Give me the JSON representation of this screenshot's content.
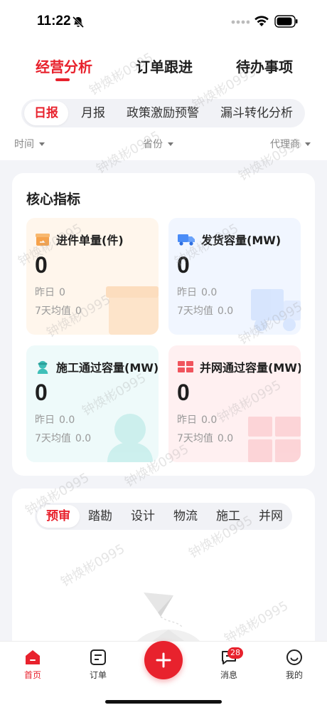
{
  "status_bar": {
    "time": "11:22"
  },
  "main_tabs": [
    {
      "label": "经营分析",
      "active": true
    },
    {
      "label": "订单跟进",
      "active": false
    },
    {
      "label": "待办事项",
      "active": false
    }
  ],
  "sub_tabs": [
    {
      "label": "日报",
      "active": true
    },
    {
      "label": "月报",
      "active": false
    },
    {
      "label": "政策激励预警",
      "active": false
    },
    {
      "label": "漏斗转化分析",
      "active": false
    }
  ],
  "filters": [
    {
      "label": "时间"
    },
    {
      "label": "省份"
    },
    {
      "label": "代理商"
    }
  ],
  "core": {
    "title": "核心指标",
    "yesterday_label": "昨日",
    "avg_label": "7天均值",
    "metrics": [
      {
        "label": "进件单量(件)",
        "value": "0",
        "yesterday": "0",
        "avg7": "0",
        "icon": "box-icon",
        "color": "#f6a24b"
      },
      {
        "label": "发货容量(MW)",
        "value": "0",
        "yesterday": "0.0",
        "avg7": "0.0",
        "icon": "truck-icon",
        "color": "#4a8cf7"
      },
      {
        "label": "施工通过容量(MW)",
        "value": "0",
        "yesterday": "0.0",
        "avg7": "0.0",
        "icon": "worker-icon",
        "color": "#3fbfb8"
      },
      {
        "label": "并网通过容量(MW)",
        "value": "0",
        "yesterday": "0.0",
        "avg7": "0.0",
        "icon": "solar-panel-icon",
        "color": "#f0545d"
      }
    ]
  },
  "flow_tabs": [
    {
      "label": "预审",
      "active": true
    },
    {
      "label": "踏勘",
      "active": false
    },
    {
      "label": "设计",
      "active": false
    },
    {
      "label": "物流",
      "active": false
    },
    {
      "label": "施工",
      "active": false
    },
    {
      "label": "并网",
      "active": false
    }
  ],
  "bottom_nav": {
    "items": [
      {
        "label": "首页",
        "icon": "home-icon",
        "active": true
      },
      {
        "label": "订单",
        "icon": "order-icon",
        "active": false
      },
      {
        "label": "消息",
        "icon": "message-icon",
        "active": false,
        "badge": "28"
      },
      {
        "label": "我的",
        "icon": "profile-icon",
        "active": false
      }
    ],
    "fab_icon": "plus-icon"
  },
  "watermark_text": "钟焕彬0995",
  "colors": {
    "accent": "#e8222d"
  }
}
